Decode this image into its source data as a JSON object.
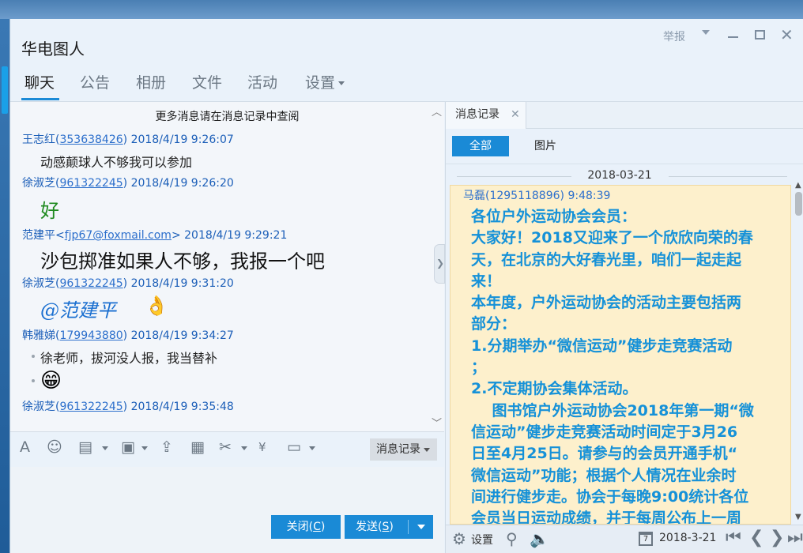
{
  "window": {
    "title": "华电图人",
    "report_label": "举报"
  },
  "tabs": [
    "聊天",
    "公告",
    "相册",
    "文件",
    "活动",
    "设置"
  ],
  "chat": {
    "more_notice": "更多消息请在消息记录中查阅",
    "messages": [
      {
        "name": "王志红",
        "qq": "353638426",
        "time": "2018/4/19 9:26:07",
        "text": "动感颠球人不够我可以参加"
      },
      {
        "name": "徐淑芝",
        "qq": "961322245",
        "time": "2018/4/19 9:26:20",
        "text": "好"
      },
      {
        "name": "范建平",
        "qq": "fjp67@foxmail.com",
        "time": "2018/4/19 9:29:21",
        "text": "沙包掷准如果人不够，我报一个吧"
      },
      {
        "name": "徐淑芝",
        "qq": "961322245",
        "time": "2018/4/19 9:31:20",
        "text": "@范建平"
      },
      {
        "name": "韩雅娣",
        "qq": "179943880",
        "time": "2018/4/19 9:34:27",
        "text": "徐老师，拔河没人报，我当替补"
      },
      {
        "name": "徐淑芝",
        "qq": "961322245",
        "time": "2018/4/19 9:35:48",
        "text": ""
      }
    ]
  },
  "toolbar": {
    "history_label": "消息记录"
  },
  "buttons": {
    "close_label": "关闭(",
    "close_key": "C",
    "send_label": "发送(",
    "send_key": "S"
  },
  "history": {
    "tab_label": "消息记录",
    "filters": [
      "全部",
      "图片"
    ],
    "date_divider": "2018-03-21",
    "entry": {
      "sender": "马磊(1295118896) 9:48:39",
      "lines": [
        "各位户外运动协会会员：",
        "大家好！2018又迎来了一个欣欣向荣的春",
        "天，在北京的大好春光里，咱们一起走起",
        "来！",
        "本年度，户外运动协会的活动主要包括两",
        "部分：",
        "1.分期举办“微信运动”健步走竞赛活动",
        "；",
        "2.不定期协会集体活动。",
        "    图书馆户外运动协会2018年第一期“微",
        "信运动”健步走竞赛活动时间定于3月26",
        "日至4月25日。请参与的会员开通手机“",
        "微信运动”功能；根据个人情况在业余时",
        "间进行健步走。协会于每晚9:00统计各位",
        "会员当日运动成绩，并于每周公布上一周"
      ]
    },
    "footer": {
      "settings_label": "设置",
      "calendar_day": "7",
      "date": "2018-3-21"
    }
  },
  "colors": {
    "accent": "#1a8ad6",
    "note_bg": "#fdf0cc",
    "note_text": "#1591d8",
    "name_link": "#1b5eb8"
  }
}
